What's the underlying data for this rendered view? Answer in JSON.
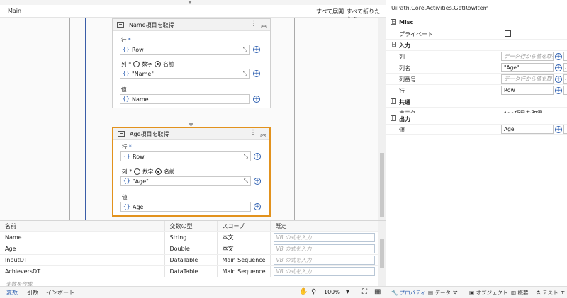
{
  "canvas": {
    "breadcrumb": "Main",
    "expand_all": "すべて展開",
    "collapse_all": "すべて折りたたむ"
  },
  "activity1": {
    "title": "Name項目を取得",
    "row_label": "行",
    "row_value": "Row",
    "col_label": "列",
    "radio_number": "数字",
    "radio_name": "名前",
    "col_value": "\"Name\"",
    "value_label": "値",
    "value": "Name"
  },
  "activity2": {
    "title": "Age項目を取得",
    "row_label": "行",
    "row_value": "Row",
    "col_label": "列",
    "radio_number": "数字",
    "radio_name": "名前",
    "col_value": "\"Age\"",
    "value_label": "値",
    "value": "Age"
  },
  "required_mark": "*",
  "variables": {
    "headers": [
      "名前",
      "変数の型",
      "スコープ",
      "既定"
    ],
    "rows": [
      {
        "name": "Name",
        "type": "String",
        "scope": "本文",
        "default": "VB の式を入力"
      },
      {
        "name": "Age",
        "type": "Double",
        "scope": "本文",
        "default": "VB の式を入力"
      },
      {
        "name": "InputDT",
        "type": "DataTable",
        "scope": "Main Sequence",
        "default": "VB の式を入力"
      },
      {
        "name": "AchieversDT",
        "type": "DataTable",
        "scope": "Main Sequence",
        "default": "VB の式を入力"
      }
    ],
    "create": "変数を作成"
  },
  "bottombar": {
    "tab_variables": "変数",
    "tab_arguments": "引数",
    "tab_imports": "インポート",
    "zoom": "100%"
  },
  "properties": {
    "title": "UiPath.Core.Activities.GetRowItem",
    "categories": {
      "misc": "Misc",
      "input": "入力",
      "common": "共通",
      "output": "出力"
    },
    "private_label": "プライベート",
    "col_label": "列",
    "col_placeholder": "データ行から値を取得",
    "colname_label": "列名",
    "colname_value": "\"Age\"",
    "colindex_label": "列番号",
    "colindex_placeholder": "データ行から値を取得",
    "row_label": "行",
    "row_value": "Row",
    "display_label": "表示名",
    "display_value": "Age項目を取得",
    "value_label": "値",
    "value_value": "Age",
    "toggle": "日",
    "dots": "..."
  },
  "props_tabs": {
    "properties": "プロパティ",
    "data_manager": "データ マ...",
    "object_repo": "オブジェクト...",
    "outline": "概要",
    "test_explorer": "テスト エ..."
  },
  "colors": {
    "accent": "#2a5db0",
    "selected_border": "#e2921d"
  }
}
